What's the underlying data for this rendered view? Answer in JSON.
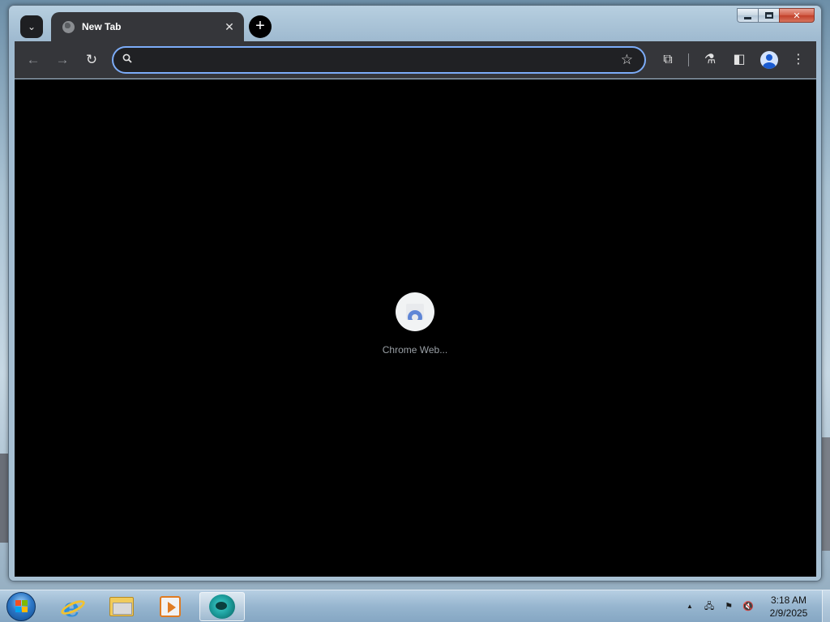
{
  "tab": {
    "title": "New Tab",
    "close_glyph": "✕"
  },
  "tabstrip": {
    "tab_search_glyph": "⌄",
    "new_tab_glyph": "+"
  },
  "toolbar": {
    "back_glyph": "←",
    "forward_glyph": "→",
    "reload_glyph": "↻",
    "omnibox_value": "",
    "star_glyph": "☆",
    "extensions_glyph": "⧉",
    "labs_glyph": "⚗",
    "side_panel_glyph": "◧",
    "menu_glyph": "⋮"
  },
  "window_controls": {
    "close_glyph": "✕"
  },
  "new_tab_page": {
    "shortcuts": [
      {
        "label": "Chrome Web..."
      }
    ]
  },
  "taskbar": {
    "apps": [
      {
        "name": "Internet Explorer",
        "icon": "ie-icon"
      },
      {
        "name": "File Explorer",
        "icon": "folder-icon"
      },
      {
        "name": "Windows Media Player",
        "icon": "media-player-icon"
      },
      {
        "name": "Chrome",
        "icon": "chrome-app-icon",
        "active": true
      }
    ],
    "tray": {
      "show_hidden_glyph": "▲",
      "network_glyph": "🖧",
      "flag_glyph": "⚑",
      "volume_glyph": "🔇"
    },
    "clock": {
      "time": "3:18 AM",
      "date": "2/9/2025"
    }
  },
  "colors": {
    "omnibox_focus_ring": "#7cacf8",
    "toolbar_bg": "#35363a",
    "content_bg": "#000000"
  }
}
